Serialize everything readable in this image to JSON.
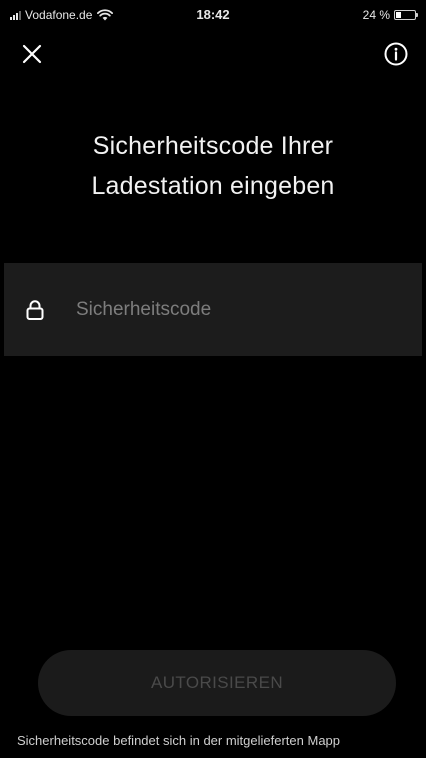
{
  "status_bar": {
    "carrier": "Vodafone.de",
    "time": "18:42",
    "battery_percent": "24 %",
    "battery_level": 0.24
  },
  "header": {
    "close_icon": "close-icon",
    "info_icon": "info-icon"
  },
  "main": {
    "title_line1": "Sicherheitscode Ihrer",
    "title_line2": "Ladestation eingeben",
    "code_field": {
      "icon": "lock-icon",
      "placeholder": "Sicherheitscode",
      "value": ""
    },
    "authorize_button": "AUTORISIEREN",
    "footer_hint": "Sicherheitscode befindet sich in der mitgelieferten Mapp"
  },
  "colors": {
    "background": "#000000",
    "field_background": "#1c1c1c",
    "button_background": "#1b1b1b",
    "button_text_disabled": "#4a4a4a",
    "placeholder": "#7d7d7d"
  }
}
